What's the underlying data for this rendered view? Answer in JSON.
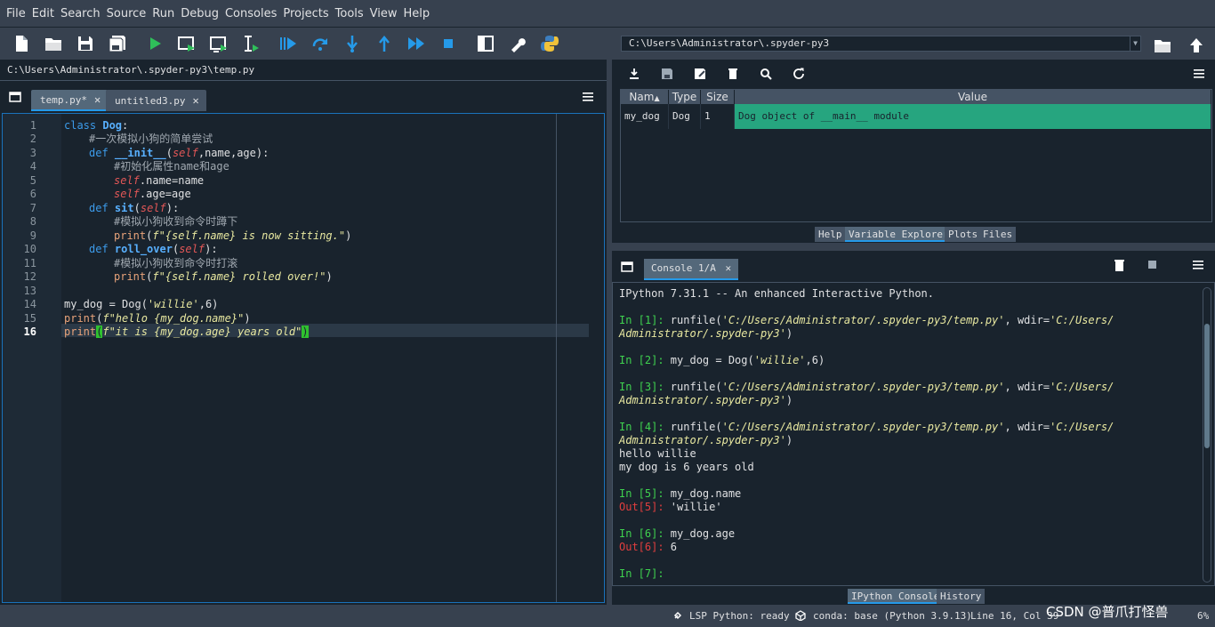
{
  "menu": [
    "File",
    "Edit",
    "Search",
    "Source",
    "Run",
    "Debug",
    "Consoles",
    "Projects",
    "Tools",
    "View",
    "Help"
  ],
  "toolbar": {
    "buttons": [
      "new-file",
      "open-file",
      "save",
      "save-all",
      "run",
      "run-cell",
      "run-cell-advance",
      "run-selection",
      "debug",
      "step",
      "step-into",
      "step-return",
      "continue",
      "stop",
      "maximize-pane",
      "preferences",
      "python-path-manager"
    ],
    "working_dir": "C:\\Users\\Administrator\\.spyder-py3"
  },
  "editor": {
    "path": "C:\\Users\\Administrator\\.spyder-py3\\temp.py",
    "tabs": [
      {
        "label": "temp.py*",
        "active": true
      },
      {
        "label": "untitled3.py",
        "active": false
      }
    ],
    "line_numbers": [
      "1",
      "2",
      "3",
      "4",
      "5",
      "6",
      "7",
      "8",
      "9",
      "10",
      "11",
      "12",
      "13",
      "14",
      "15",
      "16"
    ],
    "current_line": "16",
    "code": {
      "l1_kw": "class",
      "l1_name": "Dog",
      "l1_end": ":",
      "l2": "#一次模拟小狗的简单尝试",
      "l3_kw": "def",
      "l3_name": "__init__",
      "l3_p1": "(",
      "l3_self": "self",
      "l3_p2": ",name,age):",
      "l4": "#初始化属性name和age",
      "l5_self": "self",
      "l5_rest": ".name=name",
      "l6_self": "self",
      "l6_rest": ".age=age",
      "l7_kw": "def",
      "l7_name": "sit",
      "l7_p1": "(",
      "l7_self": "self",
      "l7_p2": "):",
      "l8": "#模拟小狗收到命令时蹲下",
      "l9_fn": "print",
      "l9_p1": "(",
      "l9_str": "f\"{self.name} is now sitting.\"",
      "l9_p2": ")",
      "l10_kw": "def",
      "l10_name": "roll_over",
      "l10_p1": "(",
      "l10_self": "self",
      "l10_p2": "):",
      "l11": "#模拟小狗收到命令时打滚",
      "l12_fn": "print",
      "l12_p1": "(",
      "l12_str": "f\"{self.name} rolled over!\"",
      "l12_p2": ")",
      "l14_a": "my_dog = Dog(",
      "l14_str": "'willie'",
      "l14_b": ",6)",
      "l15_fn": "print",
      "l15_p1": "(",
      "l15_str": "f\"hello {my_dog.name}\"",
      "l15_p2": ")",
      "l16_fn": "print",
      "l16_p1": "(",
      "l16_str": "f\"it is {my_dog.age} years old\"",
      "l16_p2": ")"
    }
  },
  "variable_explorer": {
    "columns": [
      "Nam",
      "Type",
      "Size",
      "Value"
    ],
    "rows": [
      {
        "name": "my_dog",
        "type": "Dog",
        "size": "1",
        "value": "Dog object of __main__ module"
      }
    ],
    "tabs": [
      "Help",
      "Variable Explorer",
      "Plots",
      "Files"
    ],
    "active_tab": "Variable Explorer"
  },
  "console": {
    "tab_label": "Console 1/A",
    "lines": {
      "banner": "IPython 7.31.1 -- An enhanced Interactive Python.",
      "in1_prompt": "In [1]:",
      "in1_a": " runfile(",
      "in1_s1": "'C:/Users/Administrator/.spyder-py3/temp.py'",
      "in1_b": ", wdir=",
      "in1_s2": "'C:/Users/",
      "in1_cont": "Administrator/.spyder-py3'",
      "in1_close": ")",
      "in2_prompt": "In [2]:",
      "in2_a": " my_dog = Dog(",
      "in2_s": "'willie'",
      "in2_b": ",6)",
      "in3_prompt": "In [3]:",
      "in3_a": " runfile(",
      "in3_s1": "'C:/Users/Administrator/.spyder-py3/temp.py'",
      "in3_b": ", wdir=",
      "in3_s2": "'C:/Users/",
      "in3_cont": "Administrator/.spyder-py3'",
      "in3_close": ")",
      "in4_prompt": "In [4]:",
      "in4_a": " runfile(",
      "in4_s1": "'C:/Users/Administrator/.spyder-py3/temp.py'",
      "in4_b": ", wdir=",
      "in4_s2": "'C:/Users/",
      "in4_cont": "Administrator/.spyder-py3'",
      "in4_close": ")",
      "out_hello": "hello willie",
      "out_age": "my dog is 6 years old",
      "in5_prompt": "In [5]:",
      "in5_a": " my_dog.name",
      "out5_prompt": "Out[5]:",
      "out5_val": " 'willie'",
      "in6_prompt": "In [6]:",
      "in6_a": " my_dog.age",
      "out6_prompt": "Out[6]:",
      "out6_val": " 6",
      "in7_prompt": "In [7]:"
    },
    "tabs": [
      "IPython Console",
      "History"
    ],
    "active_tab": "IPython Console"
  },
  "statusbar": {
    "lsp": "LSP Python: ready",
    "conda": "conda: base (Python 3.9.13)",
    "position": "Line 16, Col 39",
    "extra": "6%"
  },
  "watermark": "CSDN @普爪打怪兽",
  "colors": {
    "background": "#19232d",
    "panel": "#37414f",
    "accent": "#259ae9",
    "selected_row": "#26a57f",
    "prompt_in": "#3fd14f",
    "prompt_out": "#e13e3e"
  }
}
